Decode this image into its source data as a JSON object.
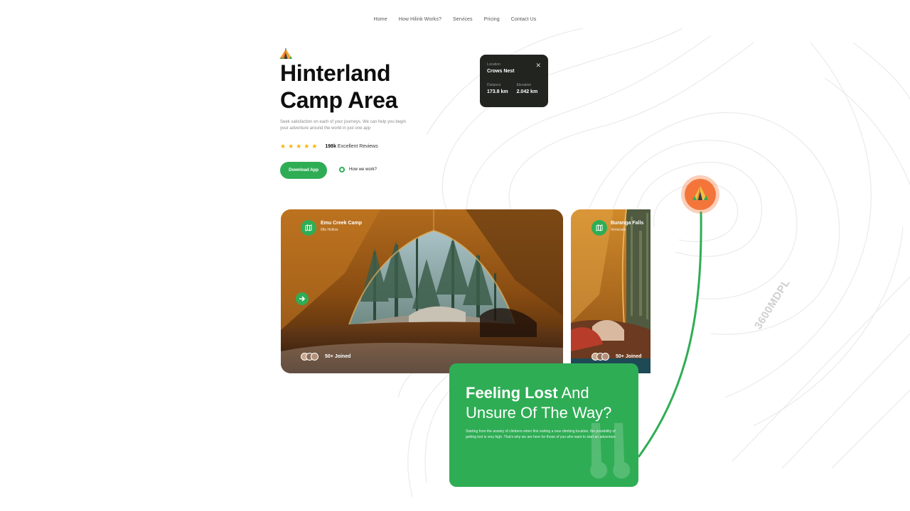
{
  "nav": {
    "items": [
      "Home",
      "How Hilink Works?",
      "Services",
      "Pricing",
      "Contact Us"
    ]
  },
  "hero": {
    "logo_icon": "tent-icon",
    "title_line1": "Hinterland",
    "title_line2": "Camp Area",
    "description": "Seek satisfaction on each of your journeys. We can help you begin your adventure around the world in just one app",
    "rating": {
      "stars": 5,
      "count": "198k",
      "label": "Excellent Reviews"
    },
    "download_button": "Download App",
    "how_we_work": "How we work?"
  },
  "location_card": {
    "location_label": "Location",
    "location_value": "Crows Nest",
    "distance_label": "Distance",
    "distance_value": "173.8 km",
    "elevation_label": "Elevation",
    "elevation_value": "2.042 km"
  },
  "camps": [
    {
      "name": "Emu Creek Camp",
      "subtitle": "68s Hollow",
      "joined": "50+ Joined"
    },
    {
      "name": "Buranga Falls",
      "subtitle": "Venerado",
      "joined": "50+ Joined"
    }
  ],
  "feature": {
    "title_bold": "Feeling Lost",
    "title_rest": " And Unsure Of The Way?",
    "description": "Starting from the anxiety of climbers when first visiting a new climbing location, the possibility of getting lost is very high. That's why we are here for those of you who want to start an adventure"
  },
  "map": {
    "elevation_label": "3600MDPL",
    "pin_icon": "tent-icon"
  },
  "colors": {
    "accent": "#2fad55",
    "pin": "#f4753a",
    "star": "#f7b500",
    "dark_card": "#222420"
  }
}
